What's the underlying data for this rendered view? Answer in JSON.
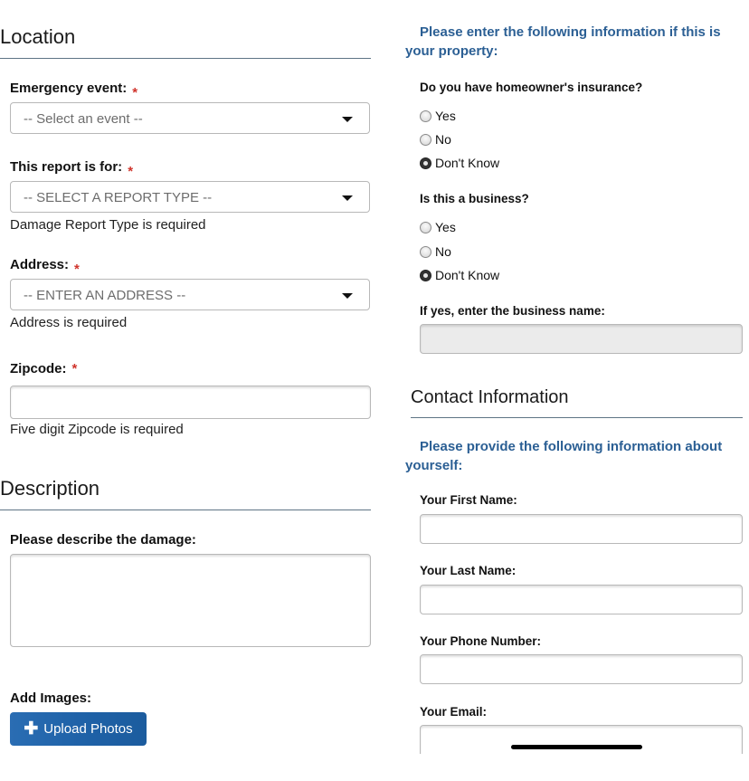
{
  "location": {
    "title": "Location",
    "emergency_event": {
      "label": "Emergency event:",
      "required_mark": "*",
      "placeholder": "-- Select an event --"
    },
    "report_for": {
      "label": "This report is for:",
      "required_mark": "*",
      "placeholder": "-- SELECT A REPORT TYPE --",
      "error": "Damage Report Type is required"
    },
    "address": {
      "label": "Address:",
      "required_mark": "*",
      "placeholder": "-- ENTER AN ADDRESS --",
      "error": "Address is required"
    },
    "zipcode": {
      "label": "Zipcode:",
      "required_mark": "*",
      "value": "",
      "error": "Five digit Zipcode is required"
    }
  },
  "description": {
    "title": "Description",
    "damage": {
      "label": "Please describe the damage:",
      "value": ""
    },
    "images": {
      "label": "Add Images:",
      "upload_button": "Upload Photos",
      "upload_icon": "plus-icon"
    }
  },
  "property": {
    "note": "Please enter the following information if this is your property:",
    "insurance": {
      "question": "Do you have homeowner's insurance?",
      "options": [
        "Yes",
        "No",
        "Don't Know"
      ],
      "selected": "Don't Know"
    },
    "business": {
      "question": "Is this a business?",
      "options": [
        "Yes",
        "No",
        "Don't Know"
      ],
      "selected": "Don't Know"
    },
    "business_name": {
      "label": "If yes, enter the business name:",
      "value": ""
    }
  },
  "contact": {
    "title": "Contact Information",
    "note": "Please provide the following information about yourself:",
    "first_name": {
      "label": "Your First Name:",
      "value": ""
    },
    "last_name": {
      "label": "Your Last Name:",
      "value": ""
    },
    "phone": {
      "label": "Your Phone Number:",
      "value": ""
    },
    "email": {
      "label": "Your Email:",
      "value": ""
    }
  },
  "colors": {
    "accent_blue": "#2b5f94",
    "button_blue": "#1f62a8",
    "required_red": "#d0342c",
    "rule": "#5e7485"
  }
}
